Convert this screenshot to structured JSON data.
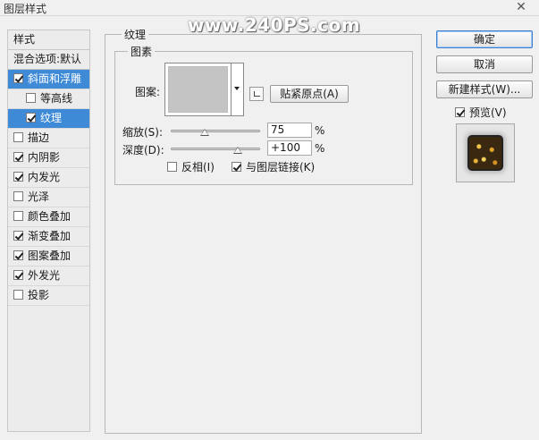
{
  "window": {
    "title": "图层样式",
    "close_glyph": "✕"
  },
  "watermark": "www.240PS.com",
  "style_list": {
    "header": "样式",
    "blend_options": "混合选项:默认",
    "items": [
      {
        "label": "斜面和浮雕",
        "checked": true,
        "selected": true,
        "sub": false
      },
      {
        "label": "等高线",
        "checked": false,
        "selected": false,
        "sub": true
      },
      {
        "label": "纹理",
        "checked": true,
        "selected": true,
        "sub": true
      },
      {
        "label": "描边",
        "checked": false,
        "selected": false,
        "sub": false
      },
      {
        "label": "内阴影",
        "checked": true,
        "selected": false,
        "sub": false
      },
      {
        "label": "内发光",
        "checked": true,
        "selected": false,
        "sub": false
      },
      {
        "label": "光泽",
        "checked": false,
        "selected": false,
        "sub": false
      },
      {
        "label": "颜色叠加",
        "checked": false,
        "selected": false,
        "sub": false
      },
      {
        "label": "渐变叠加",
        "checked": true,
        "selected": false,
        "sub": false
      },
      {
        "label": "图案叠加",
        "checked": true,
        "selected": false,
        "sub": false
      },
      {
        "label": "外发光",
        "checked": true,
        "selected": false,
        "sub": false
      },
      {
        "label": "投影",
        "checked": false,
        "selected": false,
        "sub": false
      }
    ]
  },
  "texture": {
    "group_title": "纹理",
    "elements_title": "图素",
    "pattern_label": "图案:",
    "snap_origin_button": "贴紧原点(A)",
    "scale_label": "缩放(S):",
    "scale_value": "75",
    "scale_unit": "%",
    "scale_fraction": 0.75,
    "depth_label": "深度(D):",
    "depth_value": "+100",
    "depth_unit": "%",
    "depth_fraction": 1.0,
    "invert_label": "反相(I)",
    "invert_checked": false,
    "link_label": "与图层链接(K)",
    "link_checked": true
  },
  "buttons": {
    "ok": "确定",
    "cancel": "取消",
    "new_style": "新建样式(W)..."
  },
  "preview": {
    "label": "预览(V)",
    "checked": true
  },
  "colors": {
    "selection": "#3e8ad6",
    "primary_border": "#3c7fd0"
  }
}
